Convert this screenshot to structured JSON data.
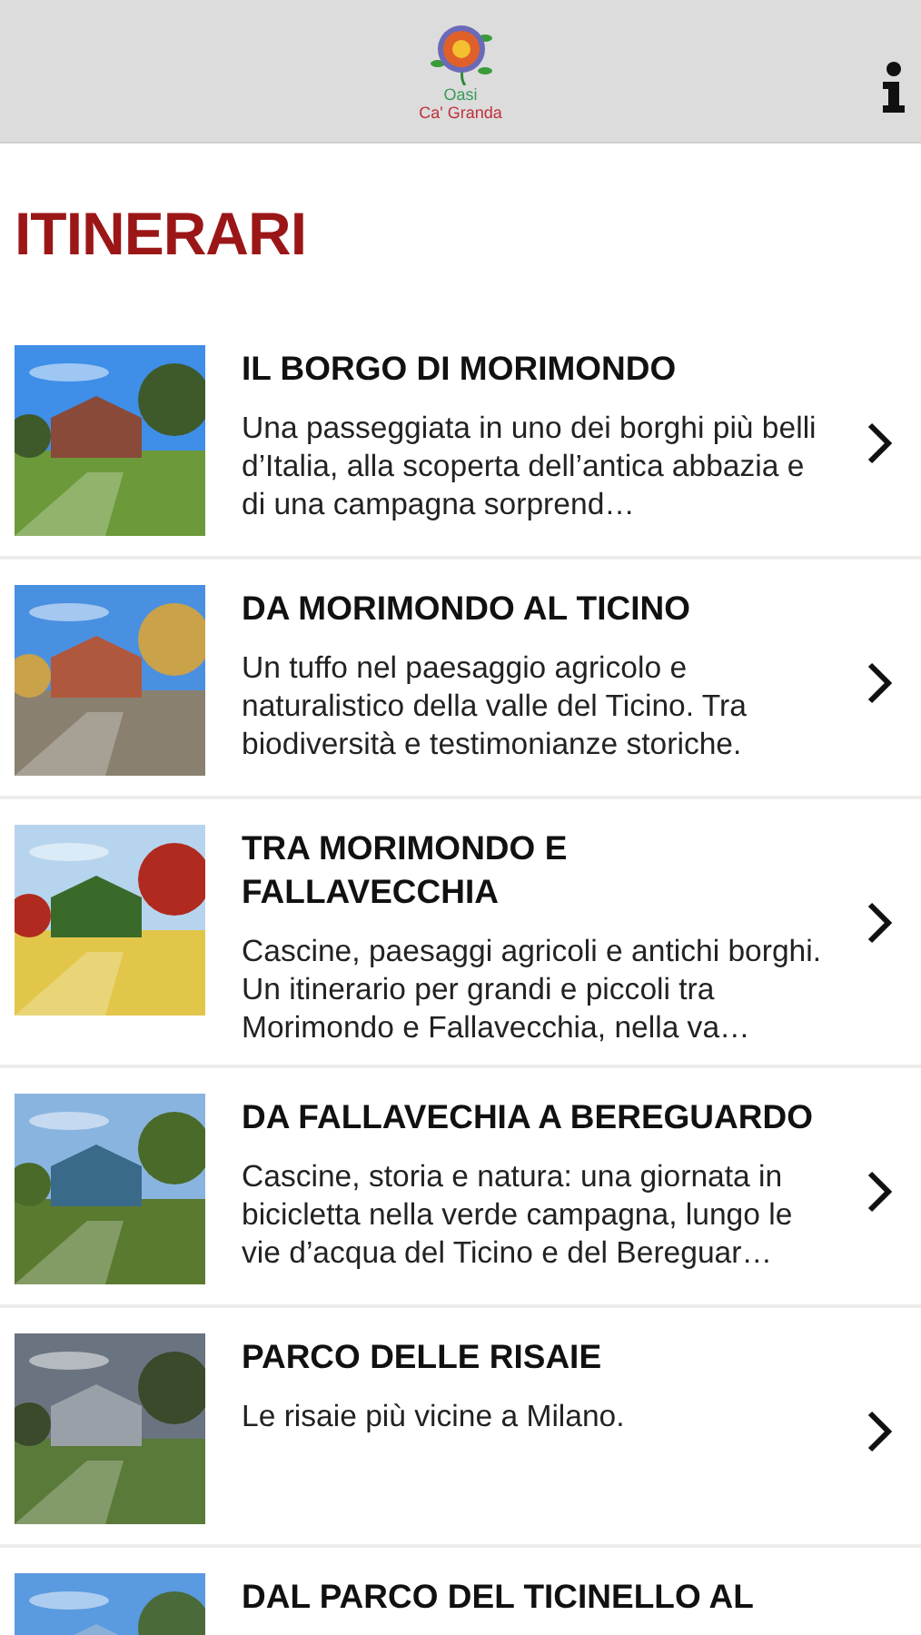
{
  "header": {
    "logo": {
      "line_1": "Oasi",
      "line_2": "Ca' Granda"
    }
  },
  "page_title": "ITINERARI",
  "itineraries": [
    {
      "title": "IL BORGO DI MORIMONDO",
      "description": "Una passeggiata in uno dei borghi più belli d’Italia, alla scoperta dell’antica abbazia e di una campagna sorprend…"
    },
    {
      "title": "DA MORIMONDO AL TICINO",
      "description": "Un tuffo nel paesaggio agricolo e naturalistico della valle del Ticino. Tra biodiversità e testimonianze storiche."
    },
    {
      "title": "TRA MORIMONDO E FALLAVECCHIA",
      "description": "Cascine, paesaggi agricoli e antichi borghi. Un itinerario per grandi e piccoli tra Morimondo e Fallavecchia, nella va…"
    },
    {
      "title": "DA FALLAVECHIA A BEREGUARDO",
      "description": "Cascine, storia e natura: una giornata in bicicletta nella verde campagna, lungo le vie d’acqua del Ticino e del Bereguar…"
    },
    {
      "title": "PARCO DELLE RISAIE",
      "description": "Le risaie più vicine a Milano."
    },
    {
      "title": "DAL PARCO DEL TICINELLO AL"
    }
  ]
}
